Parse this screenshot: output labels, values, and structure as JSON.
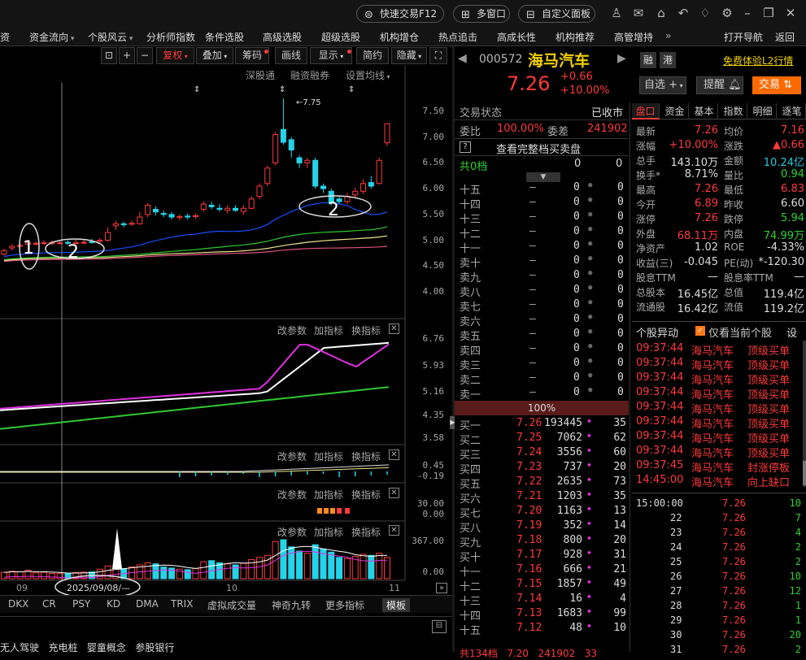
{
  "titlebar": {
    "quick_trade": "快速交易F12",
    "multi_window": "多窗口",
    "custom_panel": "自定义面板"
  },
  "menu": [
    "资金流向",
    "个股风云",
    "分析师指数",
    "条件选股",
    "高级选股",
    "超级选股",
    "机构增仓",
    "热点追击",
    "高成长性",
    "机构推荐",
    "高管增持"
  ],
  "menu_first_partial": "资",
  "menu_arrows": [
    true,
    true,
    false,
    false,
    false,
    false,
    false,
    false,
    false,
    false,
    false
  ],
  "menu_more": "»",
  "menu_right": [
    "打开导航",
    "返回"
  ],
  "chart_toolbar": {
    "buttons": [
      "复权",
      "叠加",
      "筹码",
      "画线",
      "显示",
      "简约",
      "隐藏"
    ],
    "sub_links": [
      "深股通",
      "融资融券",
      "设置均线"
    ]
  },
  "price_axis": [
    "7.50",
    "7.00",
    "6.50",
    "6.00",
    "5.50",
    "5.00",
    "4.50",
    "4.00"
  ],
  "max_price_label": "7.75",
  "annotations": [
    "1",
    "2",
    "2"
  ],
  "ind_panel_1": {
    "tools": [
      "改参数",
      "加指标",
      "换指标"
    ],
    "axis": [
      "6.76",
      "5.93",
      "5.16",
      "4.35",
      "3.58"
    ]
  },
  "ind_panel_2": {
    "tools": [
      "改参数",
      "加指标",
      "换指标"
    ],
    "axis": [
      "0.45",
      "-0.19"
    ]
  },
  "ind_panel_3": {
    "tools": [
      "改参数",
      "加指标",
      "换指标"
    ],
    "axis": [
      "30.00",
      "0.00"
    ]
  },
  "ind_panel_4": {
    "tools": [
      "改参数",
      "加指标",
      "换指标"
    ],
    "axis": [
      "367.00",
      "0.00"
    ]
  },
  "x_axis": [
    "09",
    "10",
    "11"
  ],
  "date_box": "2025/09/08/—",
  "bottom_tabs": [
    "DKX",
    "CR",
    "PSY",
    "KD",
    "DMA",
    "TRIX",
    "虚拟成交量",
    "神奇九转",
    "更多指标",
    "模板"
  ],
  "bottom_concepts": "无人驾驶   充电桩   婴童概念   参股银行",
  "stock": {
    "code": "000572",
    "name": "海马汽车",
    "price": "7.26",
    "change": "+0.66",
    "change_pct": "+10.00%",
    "tags": [
      "融",
      "港"
    ],
    "l2_link": "免费体验L2行情",
    "btn_watch": "自选",
    "btn_alert": "提醒",
    "btn_trade": "交易"
  },
  "orderbook": {
    "status_label": "交易状态",
    "status": "已收市",
    "wb_label": "委比",
    "wb": "100.00%",
    "wc_label": "委差",
    "wc": "241902",
    "full_link": "查看完整档买卖盘",
    "total_levels": "共0档",
    "total_a": "0",
    "total_b": "0",
    "sells": [
      {
        "label": "十五",
        "price": "—",
        "vol": "0",
        "cnt": "0"
      },
      {
        "label": "十四",
        "price": "—",
        "vol": "0",
        "cnt": "0"
      },
      {
        "label": "十三",
        "price": "—",
        "vol": "0",
        "cnt": "0"
      },
      {
        "label": "十二",
        "price": "—",
        "vol": "0",
        "cnt": "0"
      },
      {
        "label": "十一",
        "price": "—",
        "vol": "0",
        "cnt": "0"
      },
      {
        "label": "卖十",
        "price": "—",
        "vol": "0",
        "cnt": "0"
      },
      {
        "label": "卖九",
        "price": "—",
        "vol": "0",
        "cnt": "0"
      },
      {
        "label": "卖八",
        "price": "—",
        "vol": "0",
        "cnt": "0"
      },
      {
        "label": "卖七",
        "price": "—",
        "vol": "0",
        "cnt": "0"
      },
      {
        "label": "卖六",
        "price": "—",
        "vol": "0",
        "cnt": "0"
      },
      {
        "label": "卖五",
        "price": "—",
        "vol": "0",
        "cnt": "0"
      },
      {
        "label": "卖四",
        "price": "—",
        "vol": "0",
        "cnt": "0"
      },
      {
        "label": "卖三",
        "price": "—",
        "vol": "0",
        "cnt": "0"
      },
      {
        "label": "卖二",
        "price": "—",
        "vol": "0",
        "cnt": "0"
      },
      {
        "label": "卖一",
        "price": "—",
        "vol": "0",
        "cnt": "0"
      }
    ],
    "ratio_bar": "100%",
    "buys": [
      {
        "label": "买一",
        "price": "7.26",
        "vol": "193445",
        "cnt": "35"
      },
      {
        "label": "买二",
        "price": "7.25",
        "vol": "7062",
        "cnt": "62"
      },
      {
        "label": "买三",
        "price": "7.24",
        "vol": "3556",
        "cnt": "60"
      },
      {
        "label": "买四",
        "price": "7.23",
        "vol": "737",
        "cnt": "20"
      },
      {
        "label": "买五",
        "price": "7.22",
        "vol": "2635",
        "cnt": "73"
      },
      {
        "label": "买六",
        "price": "7.21",
        "vol": "1203",
        "cnt": "35"
      },
      {
        "label": "买七",
        "price": "7.20",
        "vol": "1163",
        "cnt": "13"
      },
      {
        "label": "买八",
        "price": "7.19",
        "vol": "352",
        "cnt": "14"
      },
      {
        "label": "买九",
        "price": "7.18",
        "vol": "800",
        "cnt": "20"
      },
      {
        "label": "买十",
        "price": "7.17",
        "vol": "928",
        "cnt": "31"
      },
      {
        "label": "十一",
        "price": "7.16",
        "vol": "666",
        "cnt": "21"
      },
      {
        "label": "十二",
        "price": "7.15",
        "vol": "1857",
        "cnt": "49"
      },
      {
        "label": "十三",
        "price": "7.14",
        "vol": "16",
        "cnt": "4"
      },
      {
        "label": "十四",
        "price": "7.13",
        "vol": "1683",
        "cnt": "99"
      },
      {
        "label": "十五",
        "price": "7.12",
        "vol": "48",
        "cnt": "10"
      }
    ],
    "footer_partial": "共134档   7.20   241902   33"
  },
  "quote_tabs": [
    "盘口",
    "资金",
    "基本",
    "指数",
    "明细",
    "逐笔"
  ],
  "quote": [
    {
      "l": "最新",
      "v": "7.26",
      "lc": "red",
      "r": "均价",
      "rv": "7.16",
      "rc": "red"
    },
    {
      "l": "涨幅",
      "v": "+10.00%",
      "lc": "red",
      "r": "涨跌",
      "rv": "▲0.66",
      "rc": "red"
    },
    {
      "l": "总手",
      "v": "143.10万",
      "lc": "white",
      "r": "金额",
      "rv": "10.24亿",
      "rc": "cyan"
    },
    {
      "l": "换手*",
      "v": "8.71%",
      "lc": "white",
      "r": "量比",
      "rv": "0.94",
      "rc": "green"
    },
    {
      "l": "最高",
      "v": "7.26",
      "lc": "red",
      "r": "最低",
      "rv": "6.83",
      "rc": "red"
    },
    {
      "l": "今开",
      "v": "6.89",
      "lc": "red",
      "r": "昨收",
      "rv": "6.60",
      "rc": "white"
    },
    {
      "l": "涨停",
      "v": "7.26",
      "lc": "red",
      "r": "跌停",
      "rv": "5.94",
      "rc": "green"
    },
    {
      "l": "外盘",
      "v": "68.11万",
      "lc": "red",
      "r": "内盘",
      "rv": "74.99万",
      "rc": "green"
    },
    {
      "l": "净资产",
      "v": "1.02",
      "lc": "white",
      "r": "ROE",
      "rv": "-4.33%",
      "rc": "white"
    },
    {
      "l": "收益(三)",
      "v": "-0.045",
      "lc": "white",
      "r": "PE(动)",
      "rv": "*-120.30",
      "rc": "white"
    },
    {
      "l": "股息TTM",
      "v": "—",
      "lc": "white",
      "r": "股息率TTM",
      "rv": "—",
      "rc": "white"
    },
    {
      "l": "总股本",
      "v": "16.45亿",
      "lc": "white",
      "r": "总值",
      "rv": "119.4亿",
      "rc": "white"
    },
    {
      "l": "流通股",
      "v": "16.42亿",
      "lc": "white",
      "r": "流值",
      "rv": "119.2亿",
      "rc": "white"
    }
  ],
  "alerts_panel": {
    "title": "个股异动",
    "filter": "仅看当前个股",
    "settings": "设",
    "rows": [
      {
        "time": "09:37:44",
        "name": "海马汽车",
        "type": "顶级买单"
      },
      {
        "time": "09:37:44",
        "name": "海马汽车",
        "type": "顶级买单"
      },
      {
        "time": "09:37:44",
        "name": "海马汽车",
        "type": "顶级买单"
      },
      {
        "time": "09:37:44",
        "name": "海马汽车",
        "type": "顶级买单"
      },
      {
        "time": "09:37:44",
        "name": "海马汽车",
        "type": "顶级买单"
      },
      {
        "time": "09:37:44",
        "name": "海马汽车",
        "type": "顶级买单"
      },
      {
        "time": "09:37:44",
        "name": "海马汽车",
        "type": "顶级买单"
      },
      {
        "time": "09:37:44",
        "name": "海马汽车",
        "type": "顶级买单"
      },
      {
        "time": "09:37:45",
        "name": "海马汽车",
        "type": "封涨停板"
      },
      {
        "time": "14:45:00",
        "name": "海马汽车",
        "type": "向上缺口"
      }
    ]
  },
  "ticks": [
    {
      "t": "15:00:00",
      "p": "7.26",
      "v": "10"
    },
    {
      "t": "22",
      "p": "7.26",
      "v": "7"
    },
    {
      "t": "23",
      "p": "7.26",
      "v": "4"
    },
    {
      "t": "24",
      "p": "7.26",
      "v": "2"
    },
    {
      "t": "25",
      "p": "7.26",
      "v": "2"
    },
    {
      "t": "26",
      "p": "7.26",
      "v": "10"
    },
    {
      "t": "27",
      "p": "7.26",
      "v": "12"
    },
    {
      "t": "28",
      "p": "7.26",
      "v": "1"
    },
    {
      "t": "29",
      "p": "7.26",
      "v": "1"
    },
    {
      "t": "30",
      "p": "7.26",
      "v": "20"
    },
    {
      "t": "31",
      "p": "7.26",
      "v": "2"
    }
  ],
  "candles": [
    {
      "o": 4.73,
      "c": 4.8,
      "h": 4.84,
      "l": 4.7
    },
    {
      "o": 4.85,
      "c": 4.88,
      "h": 4.92,
      "l": 4.8
    },
    {
      "o": 4.9,
      "c": 4.9,
      "h": 4.95,
      "l": 4.86
    },
    {
      "o": 4.92,
      "c": 4.95,
      "h": 5.0,
      "l": 4.88
    },
    {
      "o": 4.93,
      "c": 4.94,
      "h": 4.98,
      "l": 4.9
    },
    {
      "o": 4.95,
      "c": 4.95,
      "h": 5.0,
      "l": 4.91
    },
    {
      "o": 4.94,
      "c": 4.96,
      "h": 5.0,
      "l": 4.9
    },
    {
      "o": 4.95,
      "c": 4.95,
      "h": 5.0,
      "l": 4.92
    },
    {
      "o": 4.96,
      "c": 4.94,
      "h": 5.0,
      "l": 4.91
    },
    {
      "o": 4.95,
      "c": 4.95,
      "h": 5.02,
      "l": 4.92
    },
    {
      "o": 4.95,
      "c": 4.96,
      "h": 5.02,
      "l": 4.92
    },
    {
      "o": 4.97,
      "c": 4.96,
      "h": 5.03,
      "l": 4.93
    },
    {
      "o": 4.98,
      "c": 5.0,
      "h": 5.04,
      "l": 4.94
    },
    {
      "o": 5.0,
      "c": 5.15,
      "h": 5.25,
      "l": 4.98
    },
    {
      "o": 5.28,
      "c": 5.32,
      "h": 5.38,
      "l": 5.2
    },
    {
      "o": 5.32,
      "c": 5.3,
      "h": 5.36,
      "l": 5.25
    },
    {
      "o": 5.31,
      "c": 5.33,
      "h": 5.38,
      "l": 5.28
    },
    {
      "o": 5.32,
      "c": 5.45,
      "h": 5.55,
      "l": 5.3
    },
    {
      "o": 5.5,
      "c": 5.68,
      "h": 5.72,
      "l": 5.45
    },
    {
      "o": 5.6,
      "c": 5.55,
      "h": 5.66,
      "l": 5.48
    },
    {
      "o": 5.52,
      "c": 5.5,
      "h": 5.58,
      "l": 5.45
    },
    {
      "o": 5.5,
      "c": 5.45,
      "h": 5.55,
      "l": 5.4
    },
    {
      "o": 5.44,
      "c": 5.46,
      "h": 5.5,
      "l": 5.38
    },
    {
      "o": 5.47,
      "c": 5.45,
      "h": 5.52,
      "l": 5.4
    },
    {
      "o": 5.46,
      "c": 5.48,
      "h": 5.52,
      "l": 5.42
    },
    {
      "o": 5.6,
      "c": 5.7,
      "h": 5.76,
      "l": 5.55
    },
    {
      "o": 5.68,
      "c": 5.65,
      "h": 5.75,
      "l": 5.6
    },
    {
      "o": 5.62,
      "c": 5.6,
      "h": 5.7,
      "l": 5.55
    },
    {
      "o": 5.58,
      "c": 5.62,
      "h": 5.68,
      "l": 5.52
    },
    {
      "o": 5.62,
      "c": 5.58,
      "h": 5.68,
      "l": 5.55
    },
    {
      "o": 5.56,
      "c": 5.62,
      "h": 5.68,
      "l": 5.5
    },
    {
      "o": 5.62,
      "c": 5.8,
      "h": 5.85,
      "l": 5.6
    },
    {
      "o": 5.85,
      "c": 6.05,
      "h": 6.1,
      "l": 5.8
    },
    {
      "o": 6.1,
      "c": 6.4,
      "h": 6.45,
      "l": 6.05
    },
    {
      "o": 6.5,
      "c": 7.05,
      "h": 7.1,
      "l": 6.45
    },
    {
      "o": 7.15,
      "c": 6.9,
      "h": 7.75,
      "l": 6.85
    },
    {
      "o": 6.95,
      "c": 6.75,
      "h": 7.0,
      "l": 6.6
    },
    {
      "o": 6.6,
      "c": 6.5,
      "h": 6.65,
      "l": 6.4
    },
    {
      "o": 6.5,
      "c": 6.55,
      "h": 6.6,
      "l": 6.4
    },
    {
      "o": 6.55,
      "c": 6.05,
      "h": 6.6,
      "l": 6.0
    },
    {
      "o": 6.05,
      "c": 6.0,
      "h": 6.1,
      "l": 5.92
    },
    {
      "o": 5.95,
      "c": 5.72,
      "h": 6.0,
      "l": 5.68
    },
    {
      "o": 5.8,
      "c": 5.75,
      "h": 5.85,
      "l": 5.7
    },
    {
      "o": 5.75,
      "c": 5.85,
      "h": 5.92,
      "l": 5.7
    },
    {
      "o": 5.88,
      "c": 5.95,
      "h": 6.02,
      "l": 5.82
    },
    {
      "o": 5.95,
      "c": 6.1,
      "h": 6.18,
      "l": 5.9
    },
    {
      "o": 6.12,
      "c": 6.05,
      "h": 6.25,
      "l": 6.0
    },
    {
      "o": 6.1,
      "c": 6.55,
      "h": 6.6,
      "l": 6.08
    },
    {
      "o": 6.89,
      "c": 7.26,
      "h": 7.26,
      "l": 6.83
    }
  ],
  "volumes": [
    60,
    70,
    65,
    80,
    55,
    60,
    50,
    48,
    52,
    58,
    62,
    64,
    90,
    120,
    100,
    95,
    110,
    130,
    150,
    140,
    110,
    100,
    90,
    85,
    95,
    160,
    170,
    150,
    140,
    130,
    145,
    180,
    200,
    220,
    350,
    367,
    300,
    260,
    240,
    320,
    280,
    250,
    200,
    190,
    210,
    230,
    220,
    240,
    200
  ]
}
